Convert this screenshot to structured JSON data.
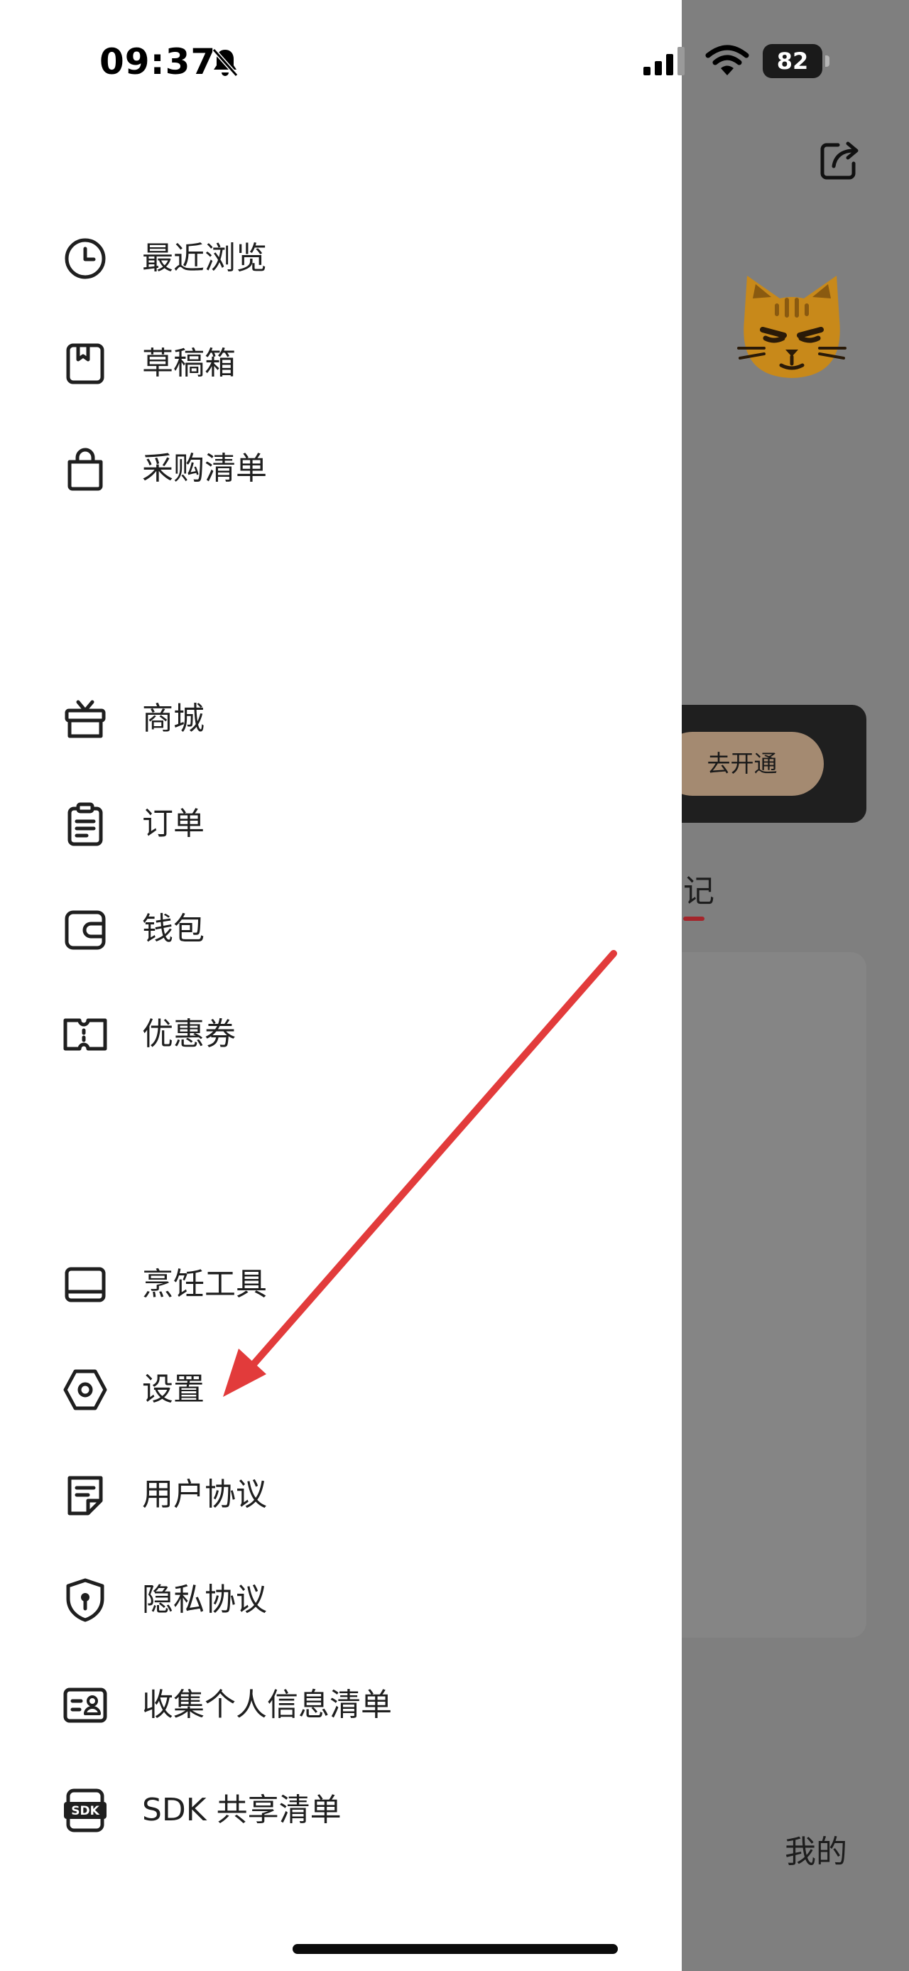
{
  "status_bar": {
    "time": "09:37",
    "battery": "82",
    "icons": [
      "bell-muted-icon",
      "cellular-signal-icon",
      "wifi-icon",
      "battery-icon"
    ]
  },
  "background_page": {
    "vip_button": "去开通",
    "tab_label": "记",
    "tabbar_label": "我的",
    "tabbar_partial": "。",
    "icons": [
      "share-icon",
      "cat-avatar"
    ]
  },
  "drawer": {
    "sections": [
      {
        "items": [
          {
            "label": "最近浏览",
            "icon": "clock-icon"
          },
          {
            "label": "草稿箱",
            "icon": "drafts-icon"
          },
          {
            "label": "采购清单",
            "icon": "shopping-bag-icon"
          }
        ]
      },
      {
        "items": [
          {
            "label": "商城",
            "icon": "gift-icon"
          },
          {
            "label": "订单",
            "icon": "clipboard-icon"
          },
          {
            "label": "钱包",
            "icon": "wallet-icon"
          },
          {
            "label": "优惠券",
            "icon": "ticket-icon"
          }
        ]
      },
      {
        "items": [
          {
            "label": "烹饪工具",
            "icon": "device-icon"
          },
          {
            "label": "设置",
            "icon": "settings-icon"
          },
          {
            "label": "用户协议",
            "icon": "document-icon"
          },
          {
            "label": "隐私协议",
            "icon": "shield-icon"
          },
          {
            "label": "收集个人信息清单",
            "icon": "id-card-icon"
          },
          {
            "label": "SDK 共享清单",
            "icon": "sdk-icon"
          }
        ]
      }
    ]
  },
  "colors": {
    "overlay": "#7f7f7f",
    "drawer_bg": "#ffffff",
    "arrow": "#e23b3b",
    "vip_button_bg": "#a48a71",
    "accent_underline": "#a4252b"
  }
}
